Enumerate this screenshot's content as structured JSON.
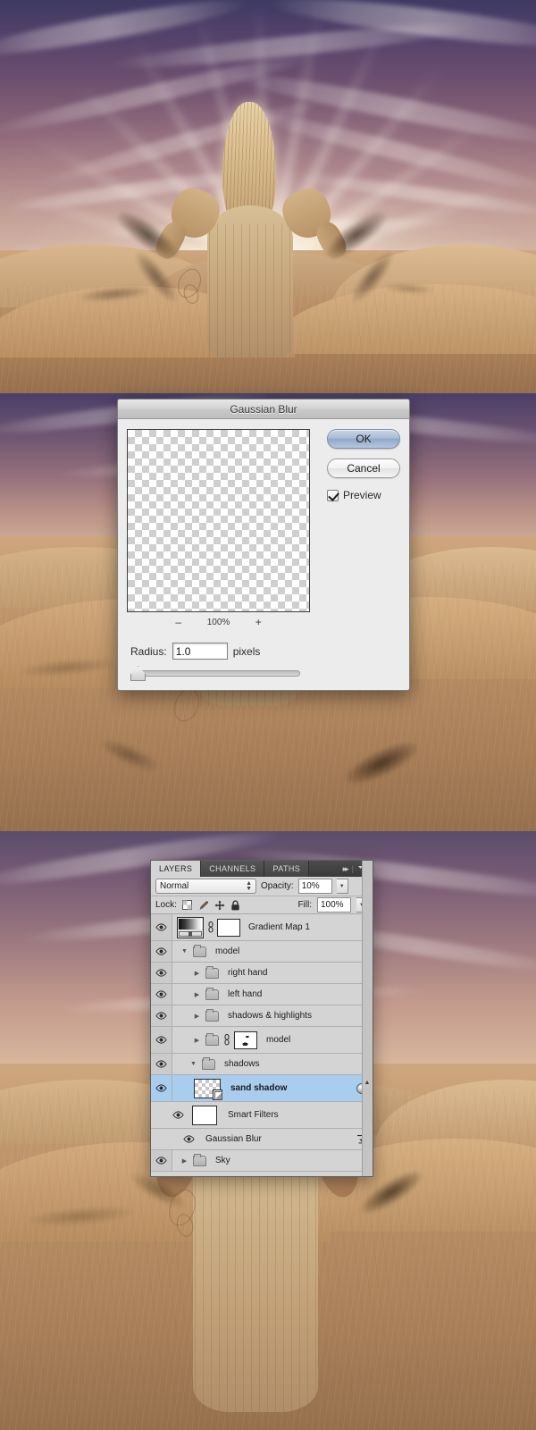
{
  "app": {
    "name": "Adobe Photoshop",
    "scene_description": "Desert dunes with woman in flowing dress"
  },
  "dialog": {
    "title": "Gaussian Blur",
    "zoom": {
      "minus": "–",
      "value": "100%",
      "plus": "+"
    },
    "radius": {
      "label": "Radius:",
      "value": "1.0",
      "units": "pixels"
    },
    "buttons": {
      "ok": "OK",
      "cancel": "Cancel"
    },
    "preview": {
      "label": "Preview",
      "checked": true
    }
  },
  "layers_panel": {
    "tabs": [
      {
        "label": "LAYERS",
        "active": true
      },
      {
        "label": "CHANNELS",
        "active": false
      },
      {
        "label": "PATHS",
        "active": false
      }
    ],
    "blend_mode": "Normal",
    "opacity_label": "Opacity:",
    "opacity_value": "10%",
    "lock_label": "Lock:",
    "lock_icons": [
      "transparency-lock-icon",
      "brush-lock-icon",
      "move-lock-icon",
      "all-lock-icon"
    ],
    "fill_label": "Fill:",
    "fill_value": "100%",
    "selection_color": "#a8cdef",
    "rows": [
      {
        "name": "Gradient Map 1",
        "type": "adjustment",
        "indent": 0,
        "visible": true,
        "selected": false,
        "has_link": true,
        "has_mask": true,
        "thumb": "gradient-map-thumbnail"
      },
      {
        "name": "model",
        "type": "group",
        "indent": 0,
        "visible": true,
        "selected": false,
        "expanded": true
      },
      {
        "name": "right hand",
        "type": "group",
        "indent": 1,
        "visible": true,
        "selected": false,
        "expanded": false
      },
      {
        "name": "left hand",
        "type": "group",
        "indent": 1,
        "visible": true,
        "selected": false,
        "expanded": false
      },
      {
        "name": "shadows & highlights",
        "type": "group",
        "indent": 1,
        "visible": true,
        "selected": false,
        "expanded": false
      },
      {
        "name": "model",
        "type": "group",
        "indent": 1,
        "visible": true,
        "selected": false,
        "expanded": false,
        "has_link": true,
        "has_mask": true
      },
      {
        "name": "shadows",
        "type": "group",
        "indent": 0,
        "visible": true,
        "selected": false,
        "expanded": true
      },
      {
        "name": "sand shadow",
        "type": "smart-object",
        "indent": 1,
        "visible": true,
        "selected": true,
        "has_fx": true
      },
      {
        "name": "Smart Filters",
        "type": "smart-filters",
        "indent": 2,
        "visible": true,
        "selected": false
      },
      {
        "name": "Gaussian Blur",
        "type": "filter",
        "indent": 3,
        "visible": true,
        "selected": false,
        "has_blending_options": true
      },
      {
        "name": "Sky",
        "type": "group",
        "indent": 0,
        "visible": true,
        "selected": false,
        "expanded": false
      }
    ]
  }
}
